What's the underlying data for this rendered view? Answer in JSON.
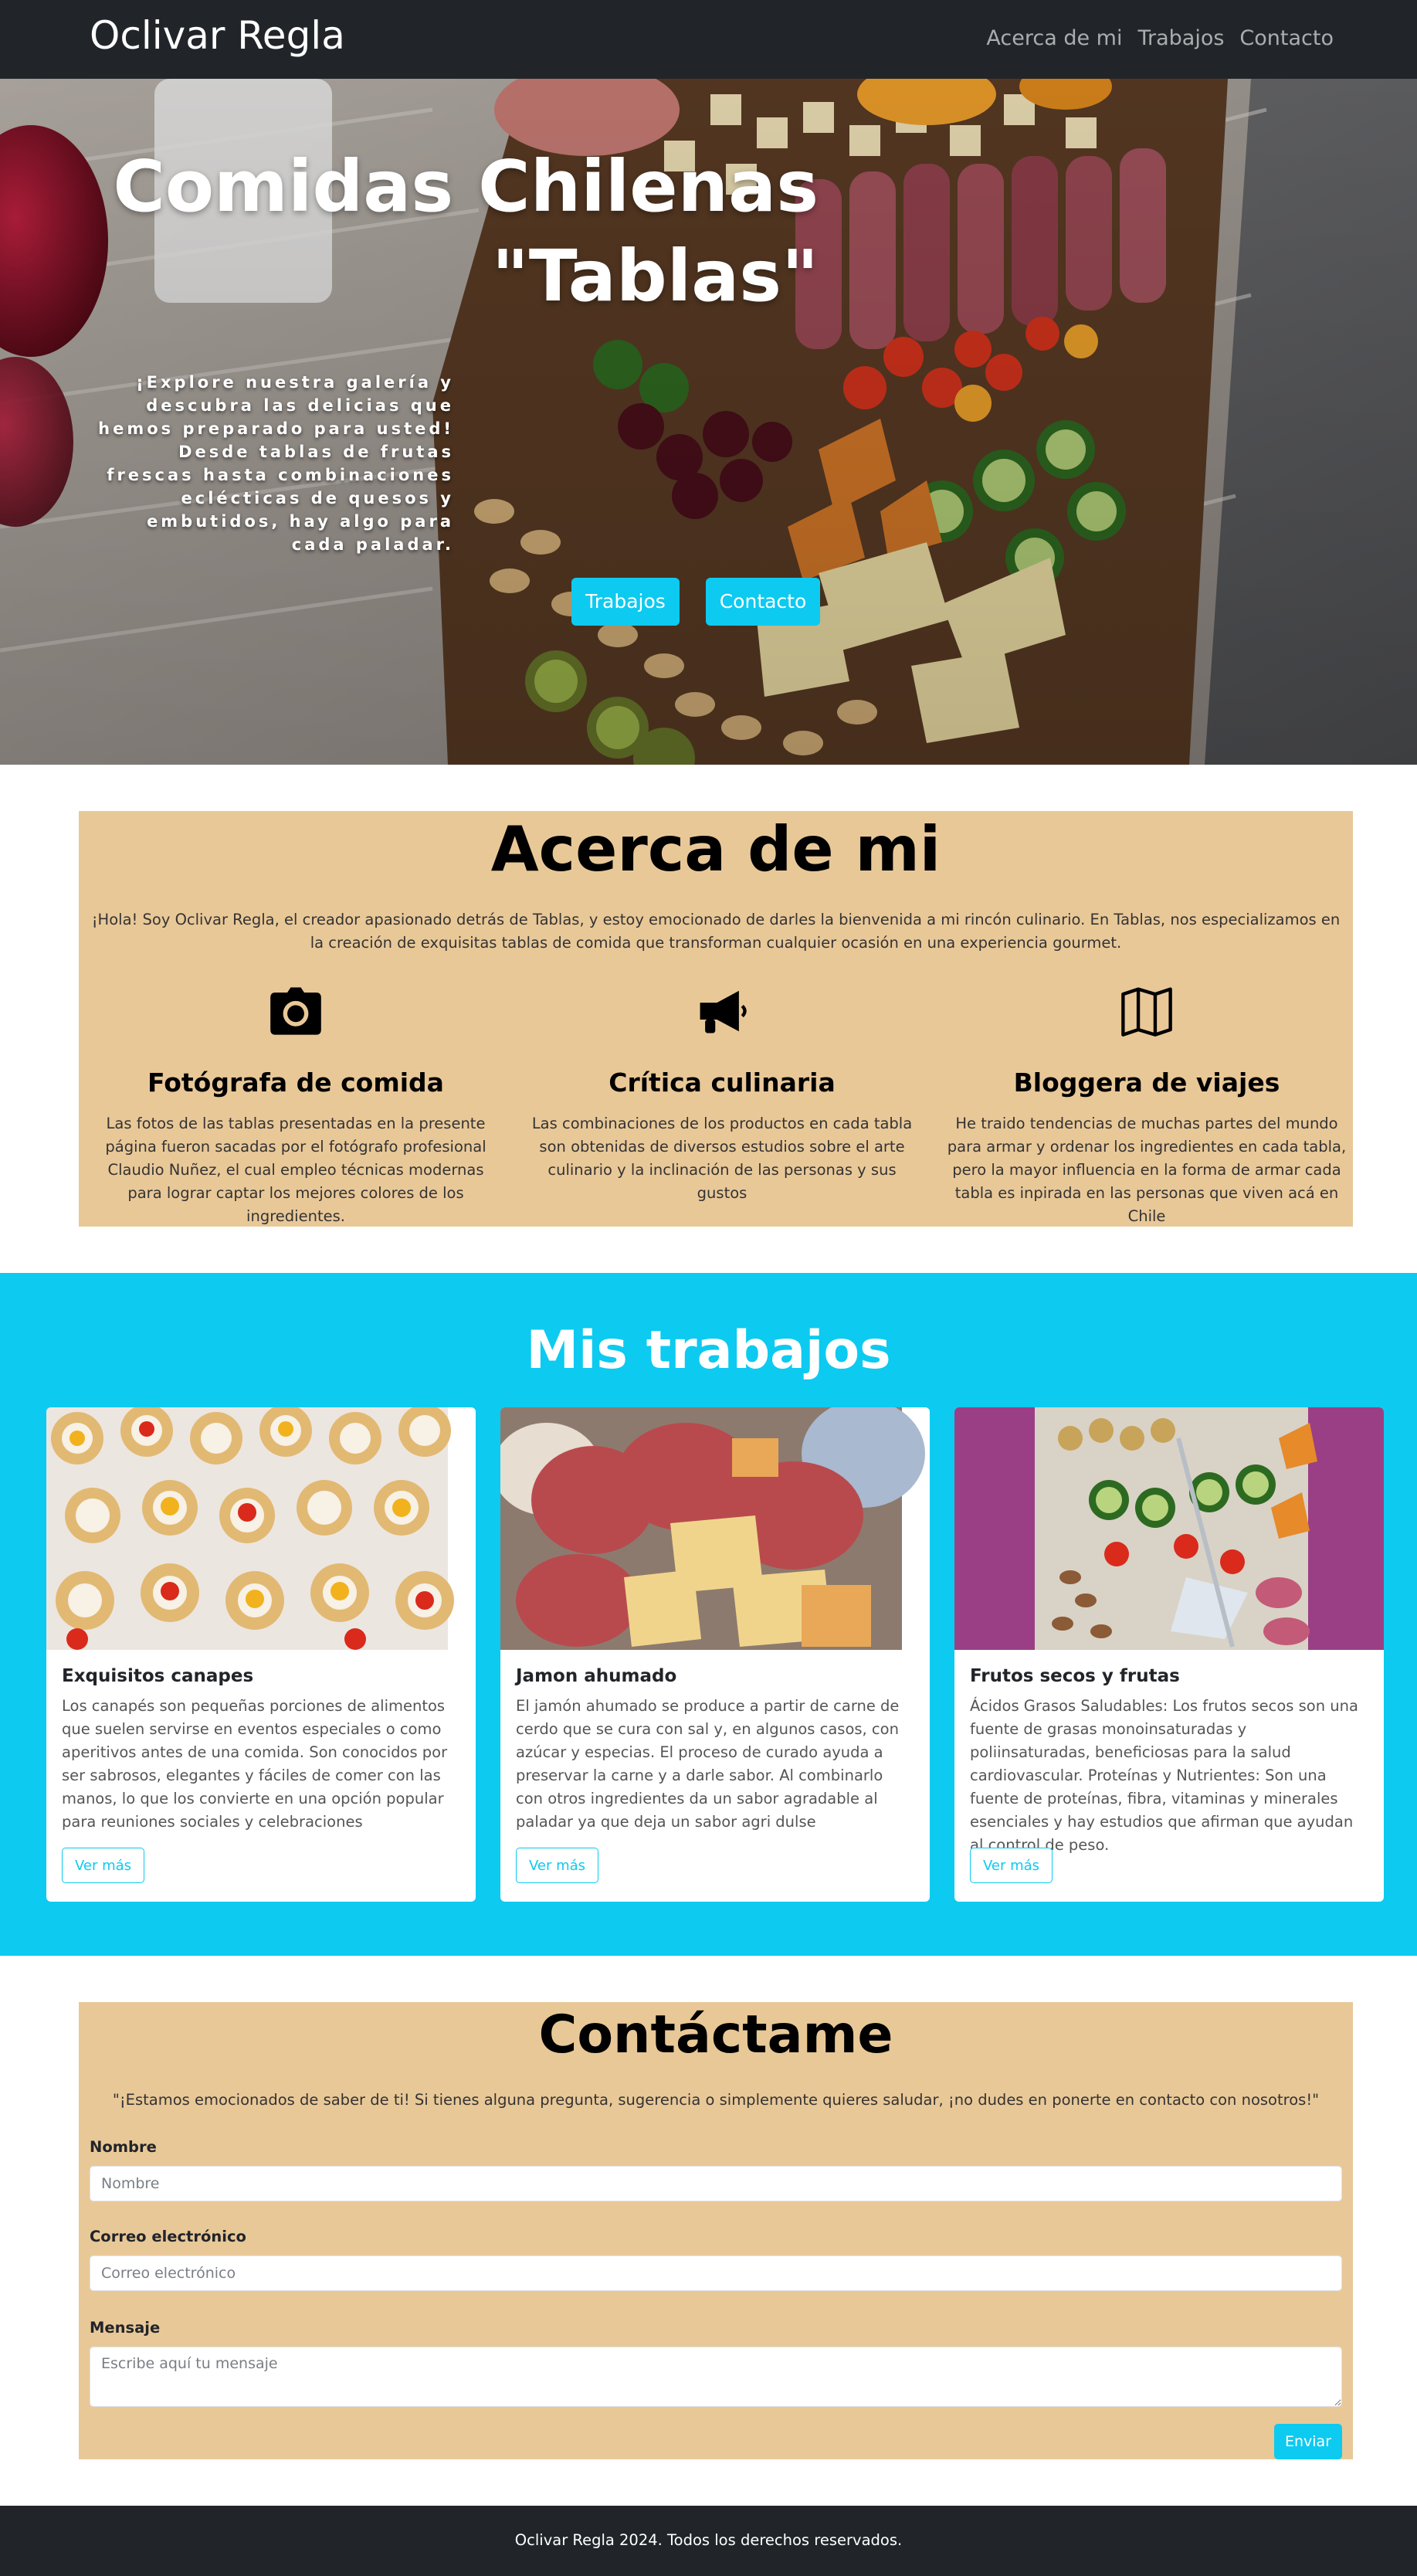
{
  "navbar": {
    "brand": "Oclivar Regla",
    "links": [
      {
        "label": "Acerca de mi"
      },
      {
        "label": "Trabajos"
      },
      {
        "label": "Contacto"
      }
    ]
  },
  "hero": {
    "title_line1": "Comidas Chilenas",
    "title_line2": "\"Tablas\"",
    "lead": "¡Explore nuestra galería y descubra las delicias que hemos preparado para usted! Desde tablas de frutas frescas hasta combinaciones eclécticas de quesos y embutidos, hay algo para cada paladar.",
    "buttons": [
      {
        "label": "Trabajos"
      },
      {
        "label": "Contacto"
      }
    ],
    "image": "charcuterie-board-photo"
  },
  "about": {
    "title": "Acerca de mi",
    "intro": "¡Hola! Soy Oclivar Regla, el creador apasionado detrás de Tablas, y estoy emocionado de darles la bienvenida a mi rincón culinario. En Tablas, nos especializamos en la creación de exquisitas tablas de comida que transforman cualquier ocasión en una experiencia gourmet.",
    "features": [
      {
        "icon": "camera-icon",
        "title": "Fotógrafa de comida",
        "text": "Las fotos de las tablas presentadas en la presente página fueron sacadas por el fotógrafo profesional Claudio Nuñez, el cual empleo técnicas modernas para lograr captar los mejores colores de los ingredientes."
      },
      {
        "icon": "megaphone-icon",
        "title": "Crítica culinaria",
        "text": "Las combinaciones de los productos en cada tabla son obtenidas de diversos estudios sobre el arte culinario y la inclinación de las personas y sus gustos"
      },
      {
        "icon": "map-icon",
        "title": "Bloggera de viajes",
        "text": "He traido tendencias de muchas partes del mundo para armar y ordenar los ingredientes en cada tabla, pero la mayor influencia en la forma de armar cada tabla es inpirada en las personas que viven acá en Chile"
      }
    ]
  },
  "works": {
    "title": "Mis trabajos",
    "cards": [
      {
        "image": "canapes-photo",
        "title": "Exquisitos canapes",
        "text": "Los canapés son pequeñas porciones de alimentos que suelen servirse en eventos especiales o como aperitivos antes de una comida. Son conocidos por ser sabrosos, elegantes y fáciles de comer con las manos, lo que los convierte en una opción popular para reuniones sociales y celebraciones",
        "button": "Ver más"
      },
      {
        "image": "jamon-photo",
        "title": "Jamon ahumado",
        "text": "El jamón ahumado se produce a partir de carne de cerdo que se cura con sal y, en algunos casos, con azúcar y especias. El proceso de curado ayuda a preservar la carne y a darle sabor. Al combinarlo con otros ingredientes da un sabor agradable al paladar ya que deja un sabor agri dulse",
        "button": "Ver más"
      },
      {
        "image": "frutos-secos-photo",
        "title": "Frutos secos y frutas",
        "text": "Ácidos Grasos Saludables: Los frutos secos son una fuente de grasas monoinsaturadas y poliinsaturadas, beneficiosas para la salud cardiovascular. Proteínas y Nutrientes: Son una fuente de proteínas, fibra, vitaminas y minerales esenciales y hay estudios que afirman que ayudan al control de peso.",
        "button": "Ver más"
      }
    ]
  },
  "contact": {
    "title": "Contáctame",
    "lead": "\"¡Estamos emocionados de saber de ti! Si tienes alguna pregunta, sugerencia o simplemente quieres saludar, ¡no dudes en ponerte en contacto con nosotros!\"",
    "name_label": "Nombre",
    "name_placeholder": "Nombre",
    "name_value": "",
    "email_label": "Correo electrónico",
    "email_placeholder": "Correo electrónico",
    "email_value": "",
    "message_label": "Mensaje",
    "message_placeholder": "Escribe aquí tu mensaje",
    "message_value": "",
    "submit": "Enviar"
  },
  "footer": {
    "text": "Oclivar Regla 2024. Todos los derechos reservados."
  },
  "colors": {
    "navbar_bg": "#212529",
    "accent": "#0dcaf0",
    "section_bg": "#e9c898",
    "footer_bg": "#212529"
  }
}
